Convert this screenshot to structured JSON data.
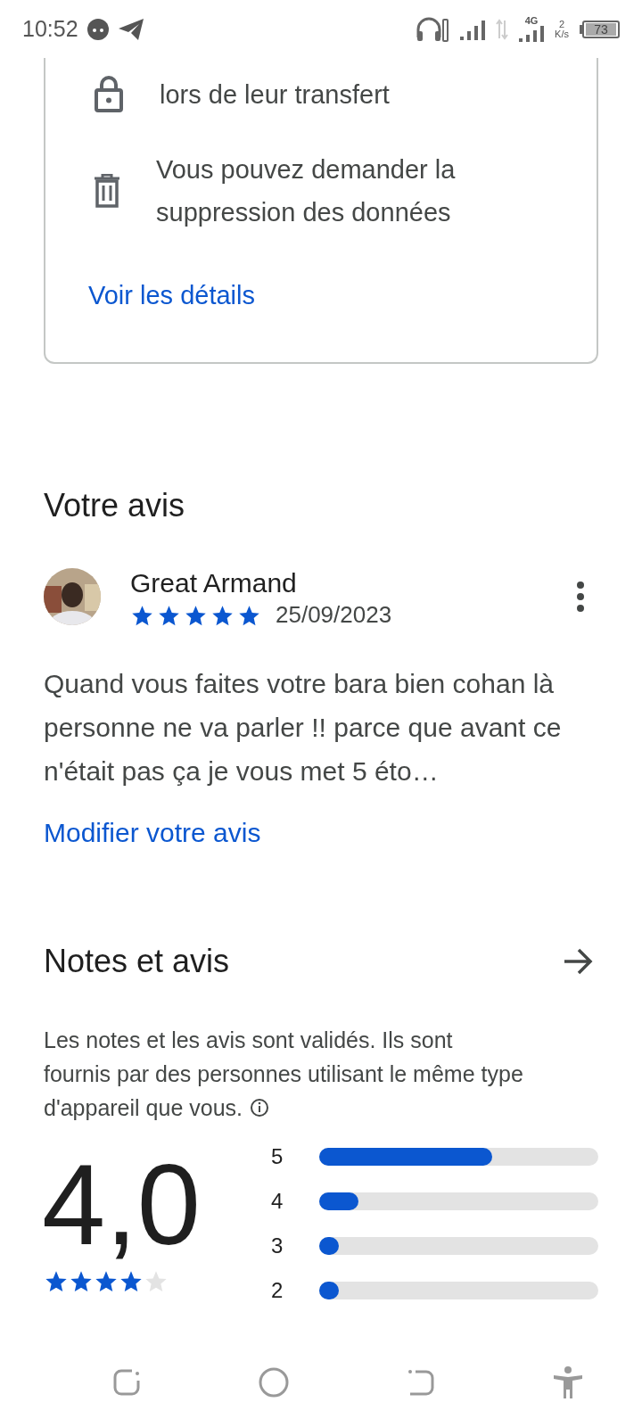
{
  "status_bar": {
    "time": "10:52",
    "network": "4G",
    "speed_value": "2",
    "speed_unit": "K/s",
    "battery": "73"
  },
  "data_safety": {
    "items": [
      {
        "kind": "lock",
        "text": "lors de leur transfert"
      },
      {
        "kind": "trash",
        "text": "Vous pouvez demander la suppression des données"
      }
    ],
    "link": "Voir les détails"
  },
  "your_review": {
    "title": "Votre avis",
    "author": "Great Armand",
    "stars": 5,
    "date": "25/09/2023",
    "text": "Quand vous faites votre bara bien cohan là personne ne va parler !! parce que avant ce n'était pas ça je vous met 5 éto…",
    "edit_link": "Modifier votre avis"
  },
  "ratings": {
    "title": "Notes et avis",
    "description": "Les notes et les avis sont validés. Ils sont fournis par des personnes utilisant le même type d'appareil que vous.",
    "score": "4,0",
    "stars": 4,
    "bars": [
      {
        "label": "5",
        "level": 0.62
      },
      {
        "label": "4",
        "level": 0.14
      },
      {
        "label": "3",
        "level": 0.07
      },
      {
        "label": "2",
        "level": 0.07
      }
    ]
  }
}
